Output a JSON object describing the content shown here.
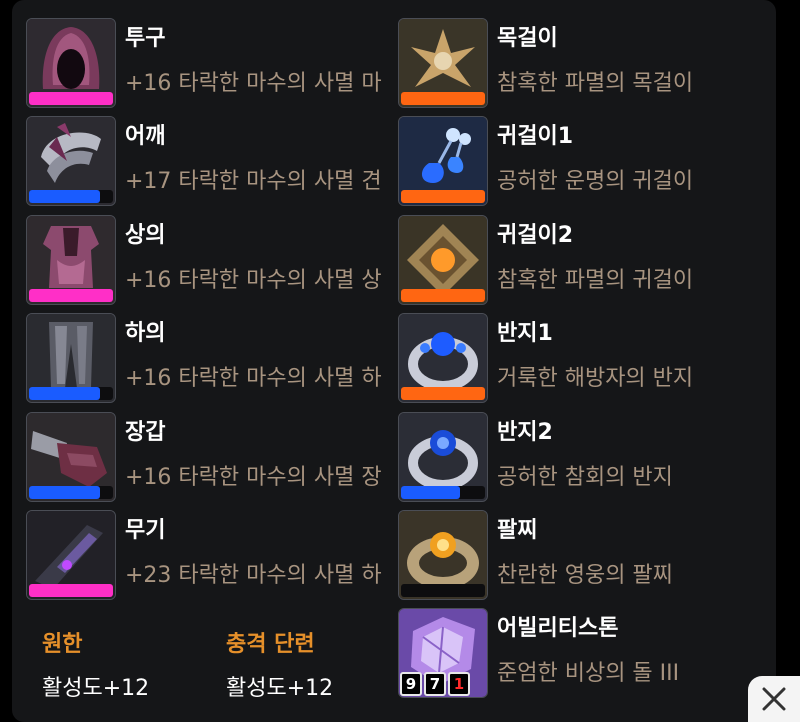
{
  "colors": {
    "panel_bg": "#151618",
    "subtitle_text": "#a89480",
    "stat_label": "#e6902a",
    "bar_pink": "#ff2fc7",
    "bar_blue": "#1a5cff",
    "bar_orange": "#ff6612"
  },
  "left_items": [
    {
      "name": "투구",
      "sub": "+16 타락한 마수의 사멸 마",
      "icon": "hood-helmet-icon",
      "bar_color": "#ff2fc7",
      "bar_fill": 1.0
    },
    {
      "name": "어깨",
      "sub": "+17 타락한 마수의 사멸 견",
      "icon": "shoulder-armor-icon",
      "bar_color": "#1a5cff",
      "bar_fill": 0.85
    },
    {
      "name": "상의",
      "sub": "+16 타락한 마수의 사멸 상",
      "icon": "chest-armor-icon",
      "bar_color": "#ff2fc7",
      "bar_fill": 1.0
    },
    {
      "name": "하의",
      "sub": "+16 타락한 마수의 사멸 하",
      "icon": "leg-armor-icon",
      "bar_color": "#1a5cff",
      "bar_fill": 0.85
    },
    {
      "name": "장갑",
      "sub": "+16 타락한 마수의 사멸 장",
      "icon": "gauntlet-icon",
      "bar_color": "#1a5cff",
      "bar_fill": 0.85
    },
    {
      "name": "무기",
      "sub": "+23 타락한 마수의 사멸 하",
      "icon": "weapon-icon",
      "bar_color": "#ff2fc7",
      "bar_fill": 1.0
    }
  ],
  "right_items": [
    {
      "name": "목걸이",
      "sub": "참혹한 파멸의 목걸이",
      "icon": "necklace-icon",
      "bar_color": "#ff6612",
      "bar_fill": 1.0
    },
    {
      "name": "귀걸이1",
      "sub": "공허한 운명의 귀걸이",
      "icon": "earring-icon",
      "bar_color": "#ff6612",
      "bar_fill": 1.0
    },
    {
      "name": "귀걸이2",
      "sub": "참혹한 파멸의 귀걸이",
      "icon": "earring-gold-icon",
      "bar_color": "#ff6612",
      "bar_fill": 1.0
    },
    {
      "name": "반지1",
      "sub": "거룩한 해방자의 반지",
      "icon": "ring-icon",
      "bar_color": "#ff6612",
      "bar_fill": 1.0
    },
    {
      "name": "반지2",
      "sub": "공허한 참회의 반지",
      "icon": "ring-blue-icon",
      "bar_color": "#1a5cff",
      "bar_fill": 0.7
    },
    {
      "name": "팔찌",
      "sub": "찬란한 영웅의 팔찌",
      "icon": "bracelet-icon",
      "bar_color": "#ff6612",
      "bar_fill": 0
    }
  ],
  "ability_stone": {
    "name": "어빌리티스톤",
    "sub": "준엄한 비상의 돌 III",
    "icon": "ability-stone-icon",
    "badges": [
      "9",
      "7",
      "1"
    ]
  },
  "stats": [
    {
      "label": "원한",
      "value": "활성도+12"
    },
    {
      "label": "충격 단련",
      "value": "활성도+12"
    }
  ],
  "close_icon": "close-icon"
}
